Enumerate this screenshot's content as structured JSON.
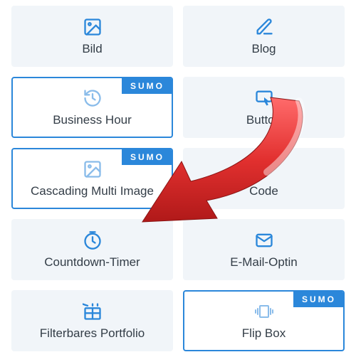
{
  "badge_text": "SUMO",
  "tiles": [
    {
      "id": "bild",
      "label": "Bild",
      "icon": "image",
      "sumo": false
    },
    {
      "id": "blog",
      "label": "Blog",
      "icon": "edit",
      "sumo": false
    },
    {
      "id": "business-hour",
      "label": "Business Hour",
      "icon": "clock-back",
      "sumo": true
    },
    {
      "id": "button",
      "label": "Button",
      "icon": "button-click",
      "sumo": false
    },
    {
      "id": "cascading",
      "label": "Cascading Multi Image",
      "icon": "image",
      "sumo": true
    },
    {
      "id": "code",
      "label": "Code",
      "icon": "code",
      "sumo": false
    },
    {
      "id": "countdown",
      "label": "Countdown-Timer",
      "icon": "clock",
      "sumo": false
    },
    {
      "id": "email",
      "label": "E-Mail-Optin",
      "icon": "mail",
      "sumo": false
    },
    {
      "id": "portfolio",
      "label": "Filterbares Portfolio",
      "icon": "grid",
      "sumo": false
    },
    {
      "id": "flipbox",
      "label": "Flip Box",
      "icon": "flip",
      "sumo": true
    }
  ]
}
